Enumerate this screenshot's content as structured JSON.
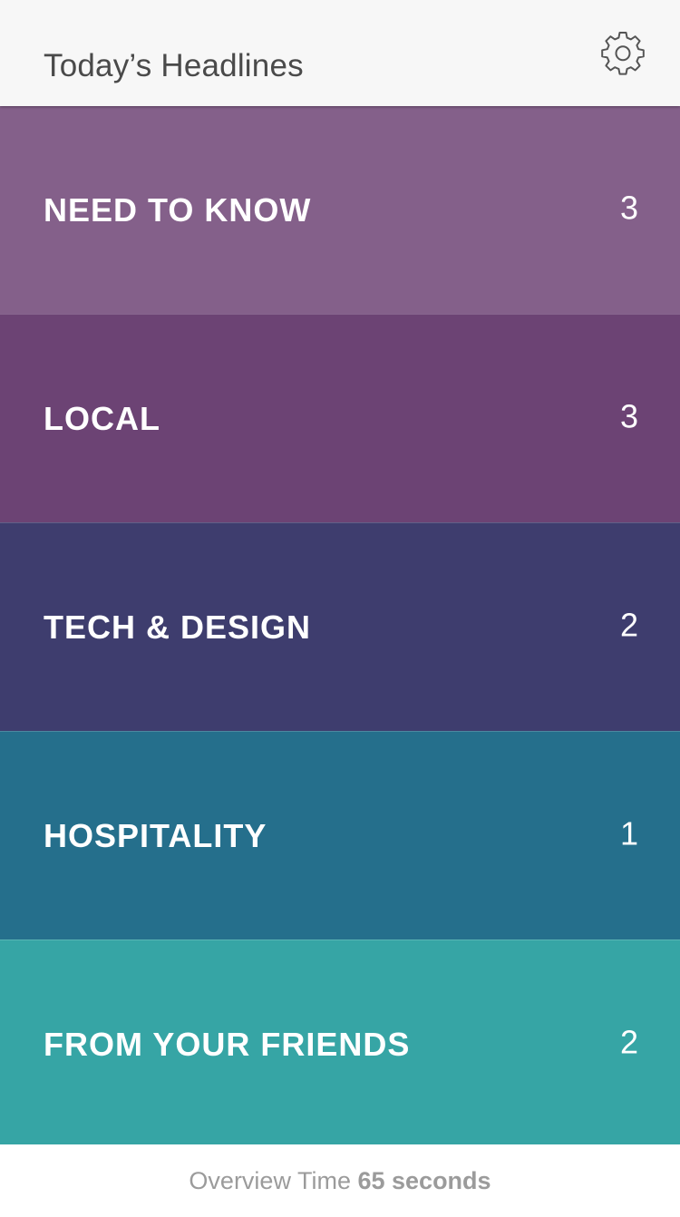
{
  "header": {
    "title": "Today’s Headlines",
    "settings_icon": "gear-icon"
  },
  "sections": [
    {
      "label": "NEED TO KNOW",
      "count": "3",
      "color": "#84608A"
    },
    {
      "label": "LOCAL",
      "count": "3",
      "color": "#6C4374"
    },
    {
      "label": "TECH & DESIGN",
      "count": "2",
      "color": "#3E3D6E"
    },
    {
      "label": "HOSPITALITY",
      "count": "1",
      "color": "#256F8C"
    },
    {
      "label": "FROM YOUR FRIENDS",
      "count": "2",
      "color": "#36A5A5"
    }
  ],
  "footer": {
    "prefix": "Overview Time",
    "value": "65 seconds"
  }
}
